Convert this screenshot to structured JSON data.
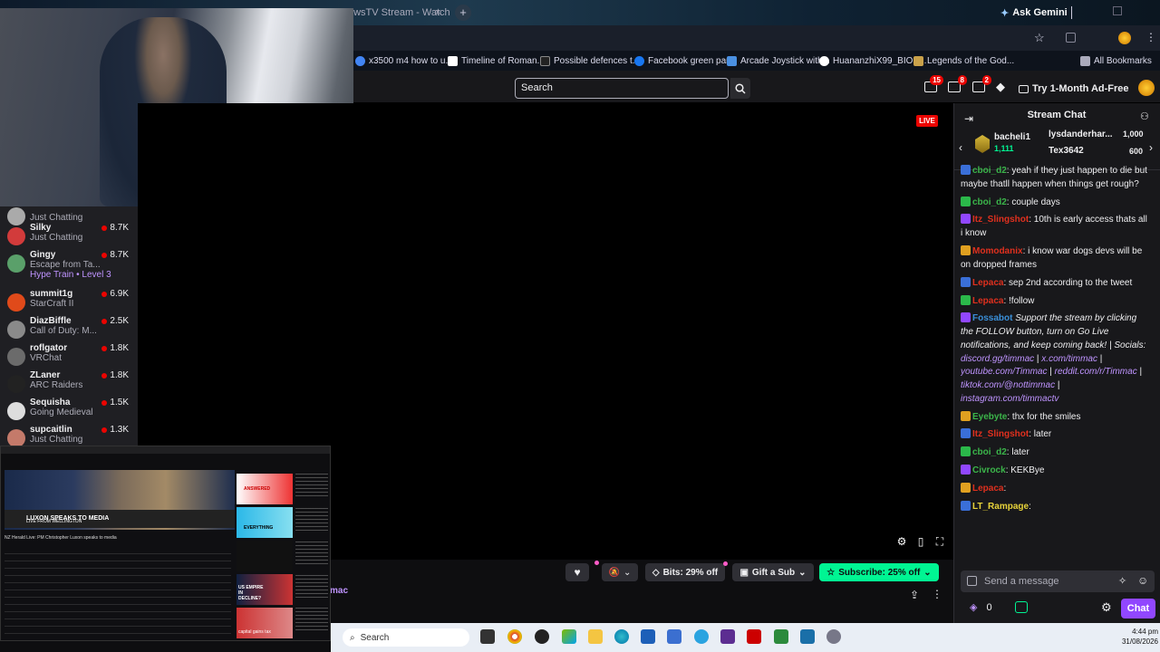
{
  "browser": {
    "active_tab_fragment": "owsTV Stream - Watch",
    "ask_gemini": "Ask Gemini",
    "bookmarks": [
      {
        "label": "x3500 m4 how to u...",
        "color": "#4285f4"
      },
      {
        "label": "Timeline of Roman...",
        "color": "#ffffff"
      },
      {
        "label": "Possible defences t...",
        "color": "#000000"
      },
      {
        "label": "Facebook green party",
        "color": "#1877f2"
      },
      {
        "label": "Arcade Joystick with...",
        "color": "#4a90e2"
      },
      {
        "label": "HuananzhiX99_BIOS...",
        "color": "#ffffff"
      },
      {
        "label": "Legends of the God...",
        "color": "#c9a14a"
      }
    ],
    "all_bookmarks": "All Bookmarks"
  },
  "topnav": {
    "search_placeholder": "Search",
    "notifications": [
      "15",
      "8",
      "2"
    ],
    "adfree_label": "Try 1-Month Ad-Free"
  },
  "sidebar": {
    "items": [
      {
        "name": "",
        "category": "Just Chatting",
        "viewers": "",
        "color": "#aaa"
      },
      {
        "name": "Silky",
        "category": "Just Chatting",
        "viewers": "8.7K",
        "color": "#d23b3b"
      },
      {
        "name": "Gingy",
        "category": "Escape from Ta...",
        "viewers": "8.7K",
        "extra": "Hype Train • Level 3",
        "color": "#5aa06a"
      },
      {
        "name": "summit1g",
        "category": "StarCraft II",
        "viewers": "6.9K",
        "color": "#e04a1a"
      },
      {
        "name": "DiazBiffle",
        "category": "Call of Duty: M...",
        "viewers": "2.5K",
        "color": "#8a8a8a"
      },
      {
        "name": "roflgator",
        "category": "VRChat",
        "viewers": "1.8K",
        "color": "#6b6b6b"
      },
      {
        "name": "ZLaner",
        "category": "ARC Raiders",
        "viewers": "1.8K",
        "color": "#222"
      },
      {
        "name": "Sequisha",
        "category": "Going Medieval",
        "viewers": "1.5K",
        "color": "#ddd"
      },
      {
        "name": "supcaitlin",
        "category": "Just Chatting",
        "viewers": "1.3K",
        "color": "#c47a6a"
      }
    ]
  },
  "video": {
    "live": "LIVE",
    "channel_fragment": "mac"
  },
  "actions": {
    "bits": "Bits: 29% off",
    "gift": "Gift a Sub",
    "subscribe": "Subscribe: 25% off"
  },
  "pip": {
    "headline": "LUXON SPEAKS TO MEDIA",
    "subhead": "LIVE FROM WELLINGTON",
    "caption": "NZ Herald Live: PM Christopher Luxon speaks to media",
    "thumb_labels": [
      "ANSWERED",
      "EVERYTHING",
      "US EMPIRE IN DECLINE?",
      "capital gains tax"
    ]
  },
  "taskbar": {
    "search": "Search",
    "time": "4:44 pm",
    "date": "31/08/2026"
  },
  "chat": {
    "title": "Stream Chat",
    "leaderboard": [
      {
        "name": "bacheli1",
        "value": "1,111"
      },
      {
        "name": "lysdanderhar...",
        "value": "1,000"
      },
      {
        "name": "Tex3642",
        "value": "600"
      }
    ],
    "messages": [
      {
        "user": "cboi_d2",
        "color": "#3bb54a",
        "text": ": yeah if they just happen to die but maybe thatll happen when things get rough?"
      },
      {
        "user": "cboi_d2",
        "color": "#3bb54a",
        "text": ": couple days"
      },
      {
        "user": "Itz_Slingshot",
        "color": "#e0301e",
        "text": ": 10th is early access thats all i know"
      },
      {
        "user": "Momodanix",
        "color": "#e0301e",
        "text": ": i know war dogs devs will be on dropped frames"
      },
      {
        "user": "Lepaca",
        "color": "#e0301e",
        "text": ": sep 2nd according to the tweet"
      },
      {
        "user": "Lepaca",
        "color": "#e0301e",
        "text": ": !follow"
      },
      {
        "user": "Fossabot",
        "color": "#3a8fd8",
        "text": " Support the stream by clicking the FOLLOW button, turn on Go Live notifications, and keep coming back! | Socials: ",
        "links": [
          "discord.gg/timmac",
          "x.com/timmac",
          "youtube.com/Timmac",
          "reddit.com/r/Timmac",
          "tiktok.com/@nottimmac",
          "instagram.com/timmactv"
        ]
      },
      {
        "user": "Eyebyte",
        "color": "#3bb54a",
        "text": ": thx for the smiles"
      },
      {
        "user": "Itz_Slingshot",
        "color": "#e0301e",
        "text": ": later"
      },
      {
        "user": "cboi_d2",
        "color": "#3bb54a",
        "text": ": later"
      },
      {
        "user": "Civrock",
        "color": "#3bb54a",
        "text": ": KEKBye"
      },
      {
        "user": "Lepaca",
        "color": "#e0301e",
        "text": ":"
      },
      {
        "user": "LT_Rampage",
        "color": "#e7d33a",
        "text": ":"
      }
    ],
    "input_placeholder": "Send a message",
    "points": "0",
    "send_label": "Chat"
  }
}
